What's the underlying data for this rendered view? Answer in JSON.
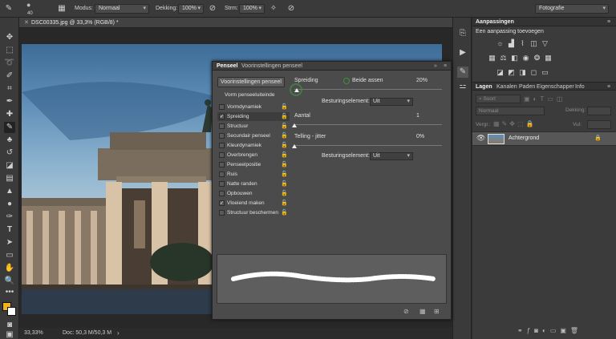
{
  "optionsbar": {
    "brush_size": "40",
    "mode_label": "Modus:",
    "mode_value": "Normaal",
    "opacity_label": "Dekking:",
    "opacity_value": "100%",
    "flow_label": "Strm:",
    "flow_value": "100%",
    "workspace": "Fotografie"
  },
  "document": {
    "tab_title": "DSC00335.jpg @ 33,3% (RGB/8) *",
    "zoom": "33,33%",
    "doc_info": "Doc: 50,3 M/50,3 M"
  },
  "brush_panel": {
    "tabs": [
      "Penseel",
      "Voorinstellingen penseel"
    ],
    "presets_button": "Voorinstellingen penseel",
    "tip_shape_button": "Vorm penseeluiteinde",
    "items": [
      {
        "label": "Vormdynamiek",
        "checked": false
      },
      {
        "label": "Spreiding",
        "checked": true
      },
      {
        "label": "Structuur",
        "checked": false
      },
      {
        "label": "Secundair penseel",
        "checked": false
      },
      {
        "label": "Kleurdynamiek",
        "checked": false
      },
      {
        "label": "Overbrengen",
        "checked": false
      },
      {
        "label": "Penseelpositie",
        "checked": false
      },
      {
        "label": "Ruis",
        "checked": false
      },
      {
        "label": "Natte randen",
        "checked": false
      },
      {
        "label": "Opbouwen",
        "checked": false
      },
      {
        "label": "Vloeiend maken",
        "checked": true
      },
      {
        "label": "Structuur beschermen",
        "checked": false
      }
    ],
    "scatter_label": "Spreiding",
    "both_axes_label": "Beide assen",
    "scatter_value": "20%",
    "control_label_1": "Besturingselement:",
    "control_value_1": "Uit",
    "count_label": "Aantal",
    "count_value": "1",
    "count_jitter_label": "Telling - jitter",
    "count_jitter_value": "0%",
    "control_label_2": "Besturingselement:",
    "control_value_2": "Uit"
  },
  "adjustments_panel": {
    "title": "Aanpassingen",
    "subtitle": "Een aanpassing toevoegen"
  },
  "layers_panel": {
    "tabs": [
      "Lagen",
      "Kanalen",
      "Paden",
      "Eigenschapper",
      "Info"
    ],
    "search_placeholder": "Soort",
    "blend_mode": "Normaal",
    "opacity_label": "Dekking:",
    "lock_label": "Vergr.:",
    "fill_label": "Vul:",
    "layers": [
      {
        "name": "Achtergrond"
      }
    ]
  },
  "colors": {
    "foreground": "#f2b31a",
    "background": "#ffffff",
    "accent_highlight": "#3e8f3e"
  }
}
